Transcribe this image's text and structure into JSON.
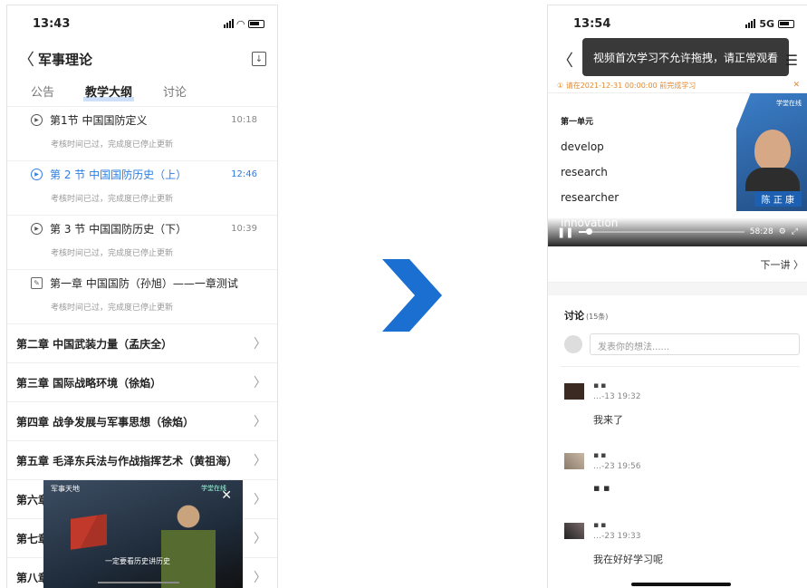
{
  "left": {
    "status": {
      "time": "13:43"
    },
    "nav": {
      "title": "军事理论",
      "back": "〈",
      "download": "↓"
    },
    "tabs": [
      "公告",
      "教学大纲",
      "讨论"
    ],
    "lessons": [
      {
        "title": "第1节 中国国防定义",
        "duration": "10:18",
        "sub": "考核时间已过，完成度已停止更新",
        "active": false,
        "kind": "video"
      },
      {
        "title": "第 2 节 中国国防历史（上）",
        "duration": "12:46",
        "sub": "考核时间已过，完成度已停止更新",
        "active": true,
        "kind": "video"
      },
      {
        "title": "第 3 节 中国国防历史（下）",
        "duration": "10:39",
        "sub": "考核时间已过，完成度已停止更新",
        "active": false,
        "kind": "video"
      },
      {
        "title": "第一章 中国国防（孙旭）——一章测试",
        "duration": "",
        "sub": "考核时间已过，完成度已停止更新",
        "active": false,
        "kind": "quiz"
      }
    ],
    "chapters": [
      "第二章 中国武装力量（孟庆全）",
      "第三章 国际战略环境（徐焰）",
      "第四章 战争发展与军事思想（徐焰）",
      "第五章 毛泽东兵法与作战指挥艺术（黄祖海）",
      "第六章",
      "第七章",
      "第八章"
    ],
    "chevron": "〉",
    "mini_video": {
      "caption": "一定要看历史讲历史",
      "close": "✕",
      "logo": "军事天地",
      "logo2": "学堂在线"
    }
  },
  "right": {
    "status": {
      "time": "13:54",
      "network": "5G"
    },
    "nav": {
      "back": "〈",
      "menu": "☰"
    },
    "toast": "视频首次学习不允许拖拽，请正常观看",
    "notice": {
      "text": "① 请在2021-12-31 00:00:00 前完成学习",
      "close": "✕"
    },
    "video": {
      "unit": "第一单元",
      "words": [
        "develop",
        "research",
        "researcher",
        "innovation"
      ],
      "teacher_name": "陈 正 康",
      "teacher_tag": "学堂在线",
      "duration": "58:28",
      "progress": 0.04
    },
    "next": "下一讲 〉",
    "discussion": {
      "title": "讨论",
      "count": "(15条)",
      "placeholder": "发表你的想法......",
      "comments": [
        {
          "user": "▪▪",
          "time": "…-13 19:32",
          "text": "我来了"
        },
        {
          "user": "▪▪",
          "time": "…-23 19:56",
          "text": "▪ ▪"
        },
        {
          "user": "▪▪",
          "time": "…-23 19:33",
          "text": "我在好好学习呢"
        }
      ]
    }
  },
  "colors": {
    "accent": "#2f7ee0",
    "arrow": "#1a6fd0",
    "notice": "#e48a2f"
  }
}
